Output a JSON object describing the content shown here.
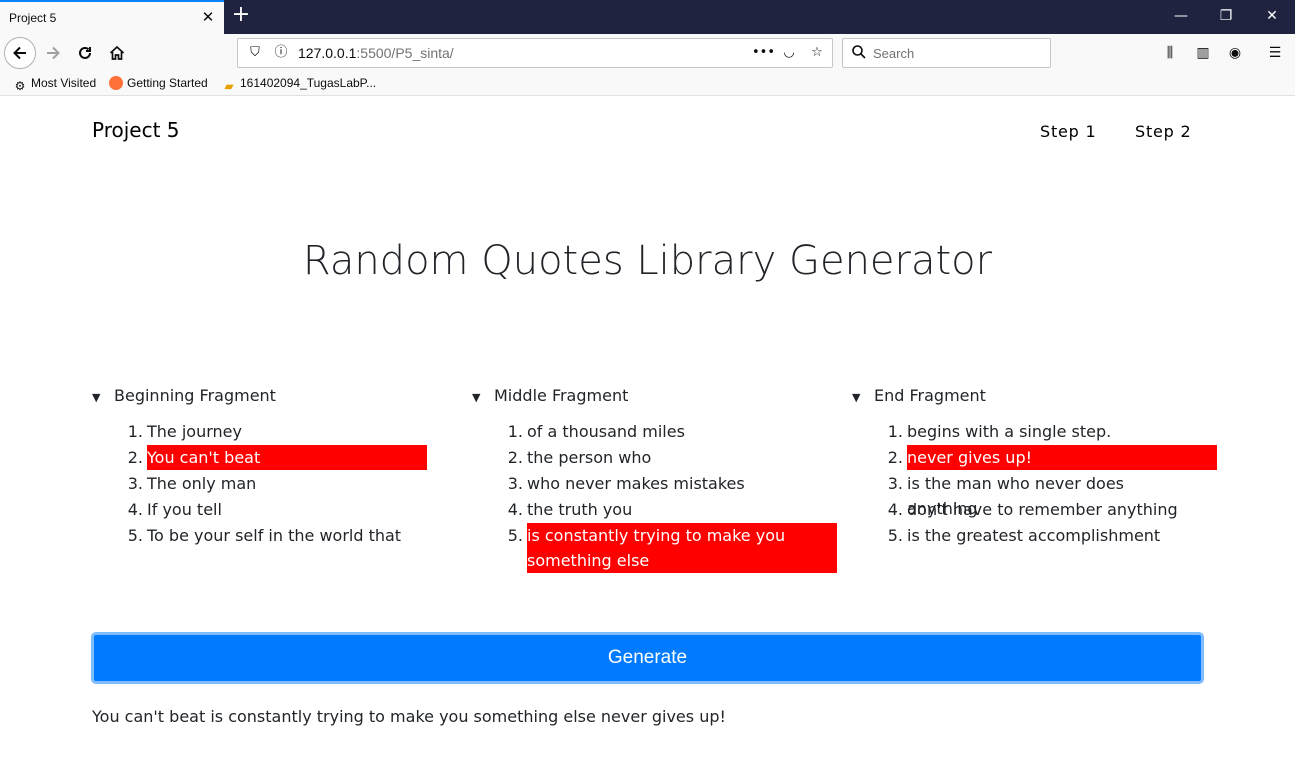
{
  "browser": {
    "tab_title": "Project 5",
    "tab_close": "✕",
    "new_tab": "+",
    "url_host": "127.0.0.1",
    "url_path": ":5500/P5_sinta/",
    "search_placeholder": "Search",
    "bookmarks": [
      "Most Visited",
      "Getting Started",
      "161402094_TugasLabP..."
    ]
  },
  "header": {
    "brand": "Project 5",
    "nav": [
      "Step 1",
      "Step 2"
    ]
  },
  "main": {
    "title": "Random Quotes Library Generator",
    "fragments": [
      {
        "label": "Beginning Fragment",
        "items": [
          "The journey",
          "You can't beat",
          "The only man",
          "If you tell",
          "To be your self in the world that"
        ],
        "selected_index": 1
      },
      {
        "label": "Middle Fragment",
        "items": [
          "of a thousand miles",
          "the person who",
          "who never makes mistakes",
          "the truth you",
          "is constantly trying to make you something else"
        ],
        "selected_index": 4
      },
      {
        "label": "End Fragment",
        "items": [
          "begins with a single step.",
          "never gives up!",
          "is the man who never does anything",
          "don't have to remember anything",
          "is the greatest accomplishment"
        ],
        "selected_index": 1
      }
    ],
    "generate_label": "Generate",
    "result": "You can't beat is constantly trying to make you something else never gives up!"
  },
  "colors": {
    "highlight": "#ff0000",
    "button": "#007bff",
    "tab_accent": "#0a84ff"
  }
}
